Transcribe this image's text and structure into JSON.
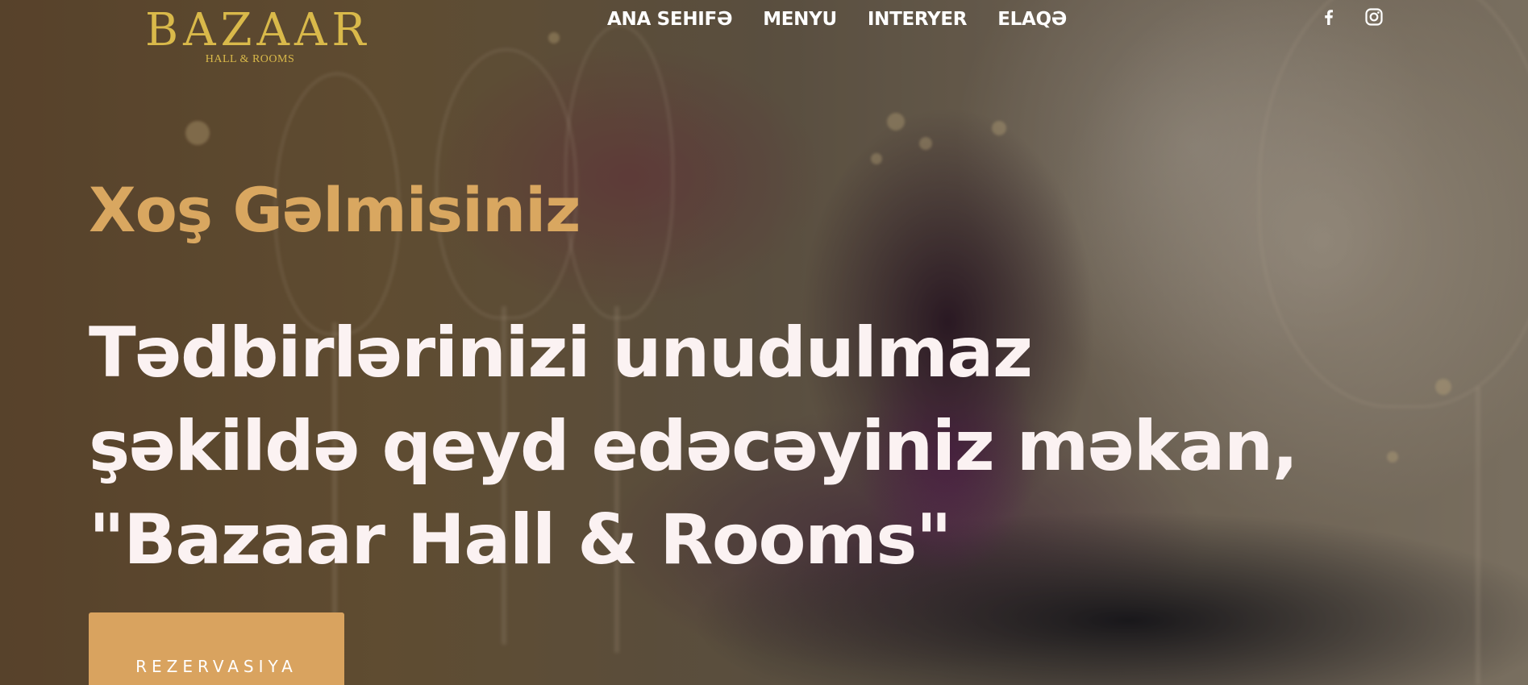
{
  "brand": {
    "logo_word": "BAZAAR",
    "logo_sub": "HALL & ROOMS",
    "accent_color": "#d9b94a"
  },
  "nav": {
    "items": [
      {
        "label": "ANA SEHIFƏ"
      },
      {
        "label": "MENYU"
      },
      {
        "label": "INTERYER"
      },
      {
        "label": "ELAQƏ"
      }
    ]
  },
  "social": {
    "icons": [
      "facebook-icon",
      "instagram-icon"
    ]
  },
  "hero": {
    "welcome": "Xoş Gəlmisiniz",
    "welcome_color": "#d9a760",
    "headline_lines": [
      "Tədbirlərinizi unudulmaz",
      "şəkildə qeyd edəcəyiniz məkan,",
      "\"Bazaar Hall & Rooms\""
    ],
    "headline_color": "#fbf2f2",
    "cta_label": "REZERVASIYA",
    "cta_color": "#d9a35f"
  }
}
